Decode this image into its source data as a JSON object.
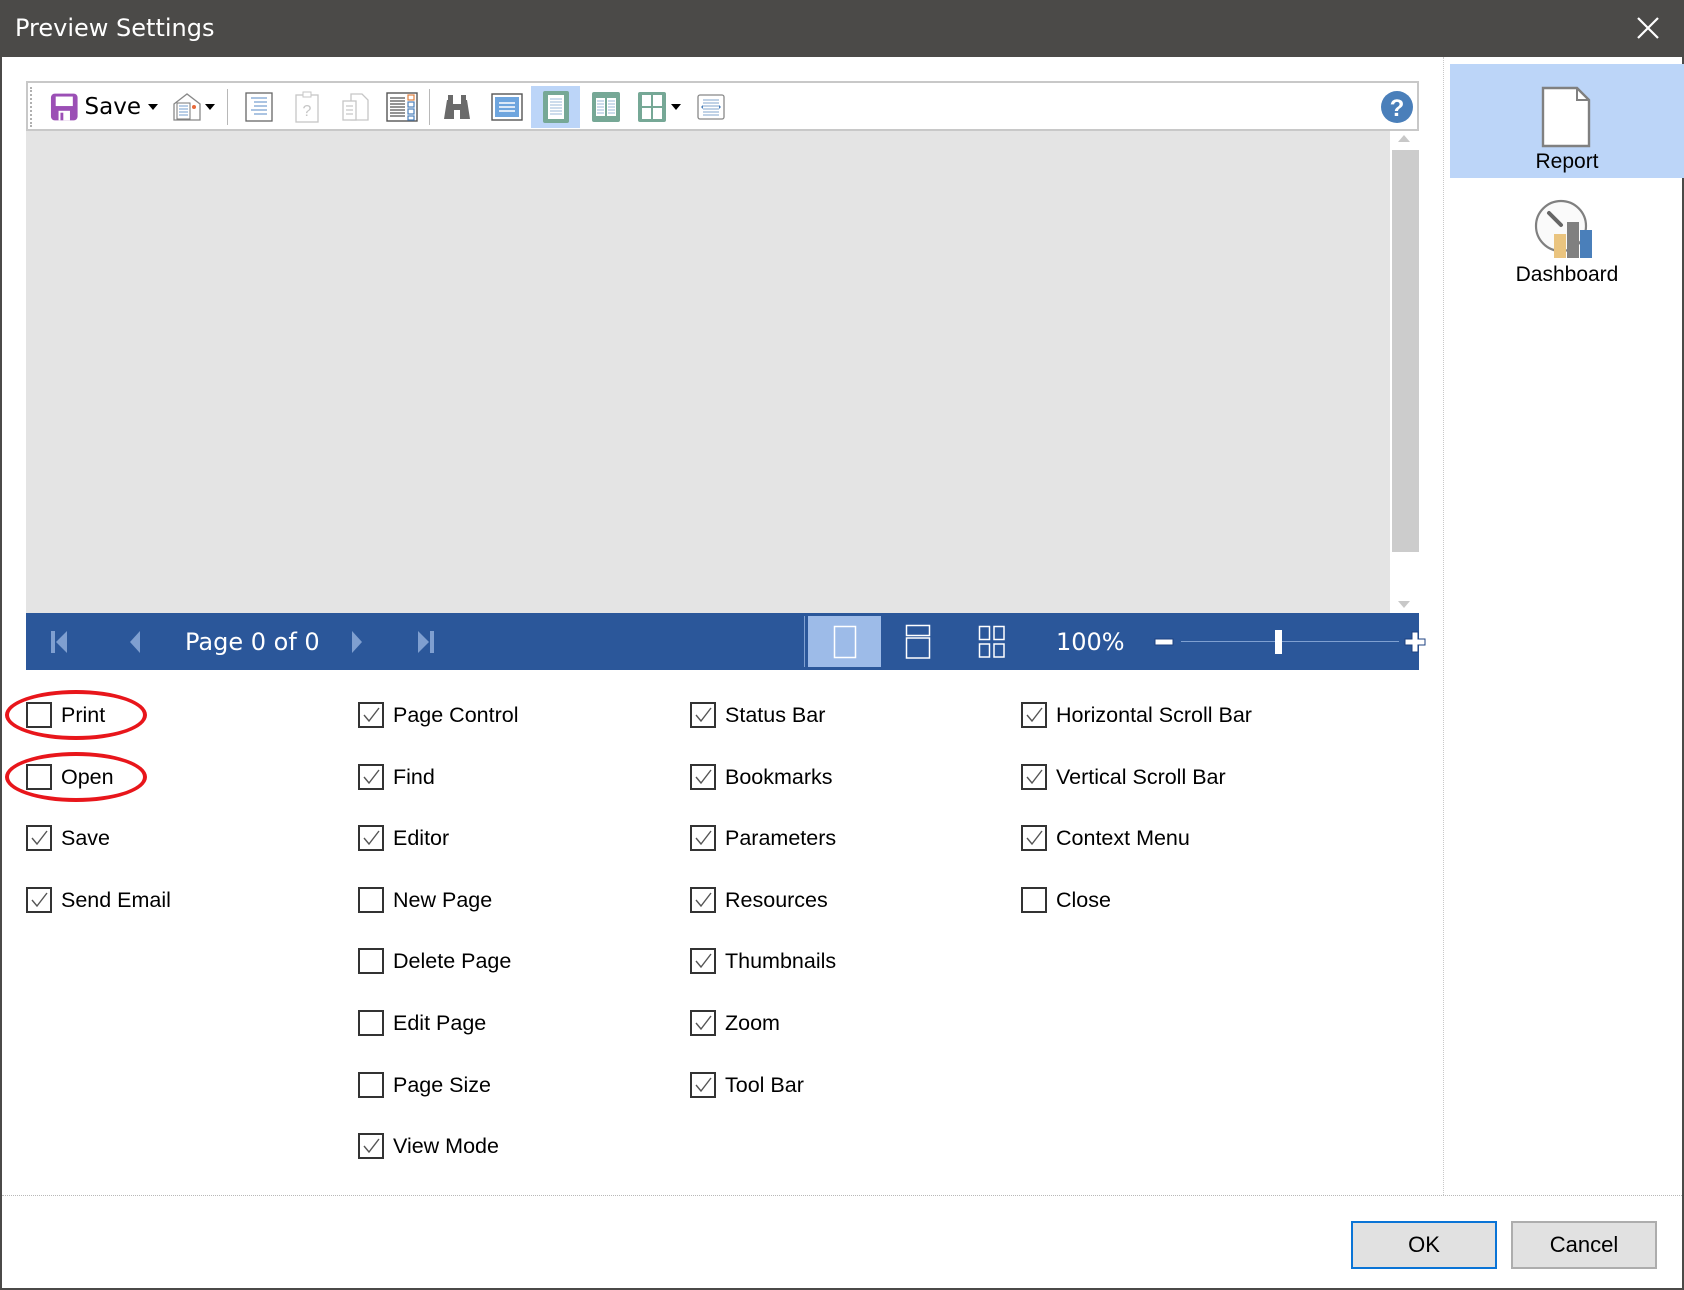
{
  "window": {
    "title": "Preview Settings",
    "close_icon": "close-x-icon"
  },
  "toolbar": {
    "save_label": "Save",
    "buttons": [
      {
        "name": "save",
        "icon": "floppy-disk-icon",
        "has_dropdown": true
      },
      {
        "name": "send-email",
        "icon": "envelope-document-icon",
        "has_dropdown": true
      },
      {
        "name": "bookmarks",
        "icon": "document-lines-icon"
      },
      {
        "name": "parameters",
        "icon": "clipboard-question-icon",
        "disabled": true
      },
      {
        "name": "resources",
        "icon": "documents-copy-icon",
        "disabled": true
      },
      {
        "name": "thumbnails",
        "icon": "document-thumbnails-icon"
      },
      {
        "name": "find",
        "icon": "binoculars-icon"
      },
      {
        "name": "editor",
        "icon": "editor-page-icon"
      },
      {
        "name": "single-page",
        "icon": "single-page-icon",
        "active": true
      },
      {
        "name": "two-pages",
        "icon": "two-pages-icon"
      },
      {
        "name": "multiple-pages",
        "icon": "multi-page-icon",
        "has_dropdown": true
      },
      {
        "name": "page-width",
        "icon": "page-width-icon"
      }
    ],
    "help_icon": "help-question-icon"
  },
  "statusbar": {
    "page_text": "Page 0 of 0",
    "zoom_text": "100%",
    "zoom_percent": 100,
    "view_modes": [
      {
        "name": "single-page-view",
        "active": true
      },
      {
        "name": "continuous-view",
        "active": false
      },
      {
        "name": "multiple-pages-view",
        "active": false
      }
    ]
  },
  "side_panel": {
    "items": [
      {
        "label": "Report",
        "icon": "report-page-icon",
        "active": true
      },
      {
        "label": "Dashboard",
        "icon": "dashboard-gauge-icon",
        "active": false
      }
    ]
  },
  "options": {
    "columns": [
      [
        {
          "label": "Print",
          "checked": false,
          "highlighted": true
        },
        {
          "label": "Open",
          "checked": false,
          "highlighted": true
        },
        {
          "label": "Save",
          "checked": true
        },
        {
          "label": "Send Email",
          "checked": true
        }
      ],
      [
        {
          "label": "Page Control",
          "checked": true
        },
        {
          "label": "Find",
          "checked": true
        },
        {
          "label": "Editor",
          "checked": true
        },
        {
          "label": "New Page",
          "checked": false
        },
        {
          "label": "Delete Page",
          "checked": false
        },
        {
          "label": "Edit Page",
          "checked": false
        },
        {
          "label": "Page Size",
          "checked": false
        },
        {
          "label": "View Mode",
          "checked": true
        }
      ],
      [
        {
          "label": "Status Bar",
          "checked": true
        },
        {
          "label": "Bookmarks",
          "checked": true
        },
        {
          "label": "Parameters",
          "checked": true
        },
        {
          "label": "Resources",
          "checked": true
        },
        {
          "label": "Thumbnails",
          "checked": true
        },
        {
          "label": "Zoom",
          "checked": true
        },
        {
          "label": "Tool Bar",
          "checked": true
        }
      ],
      [
        {
          "label": "Horizontal Scroll Bar",
          "checked": true
        },
        {
          "label": "Vertical Scroll Bar",
          "checked": true
        },
        {
          "label": "Context Menu",
          "checked": true
        },
        {
          "label": "Close",
          "checked": false
        }
      ]
    ]
  },
  "footer": {
    "ok_label": "OK",
    "cancel_label": "Cancel"
  },
  "colors": {
    "titlebar": "#4b4a48",
    "statusbar": "#2b579a",
    "active_highlight": "#bcd5f8",
    "annotation_ring": "#e8161b",
    "save_icon": "#9b4fb5",
    "view_icon_green": "#76a896",
    "help_blue": "#4a7fba"
  }
}
